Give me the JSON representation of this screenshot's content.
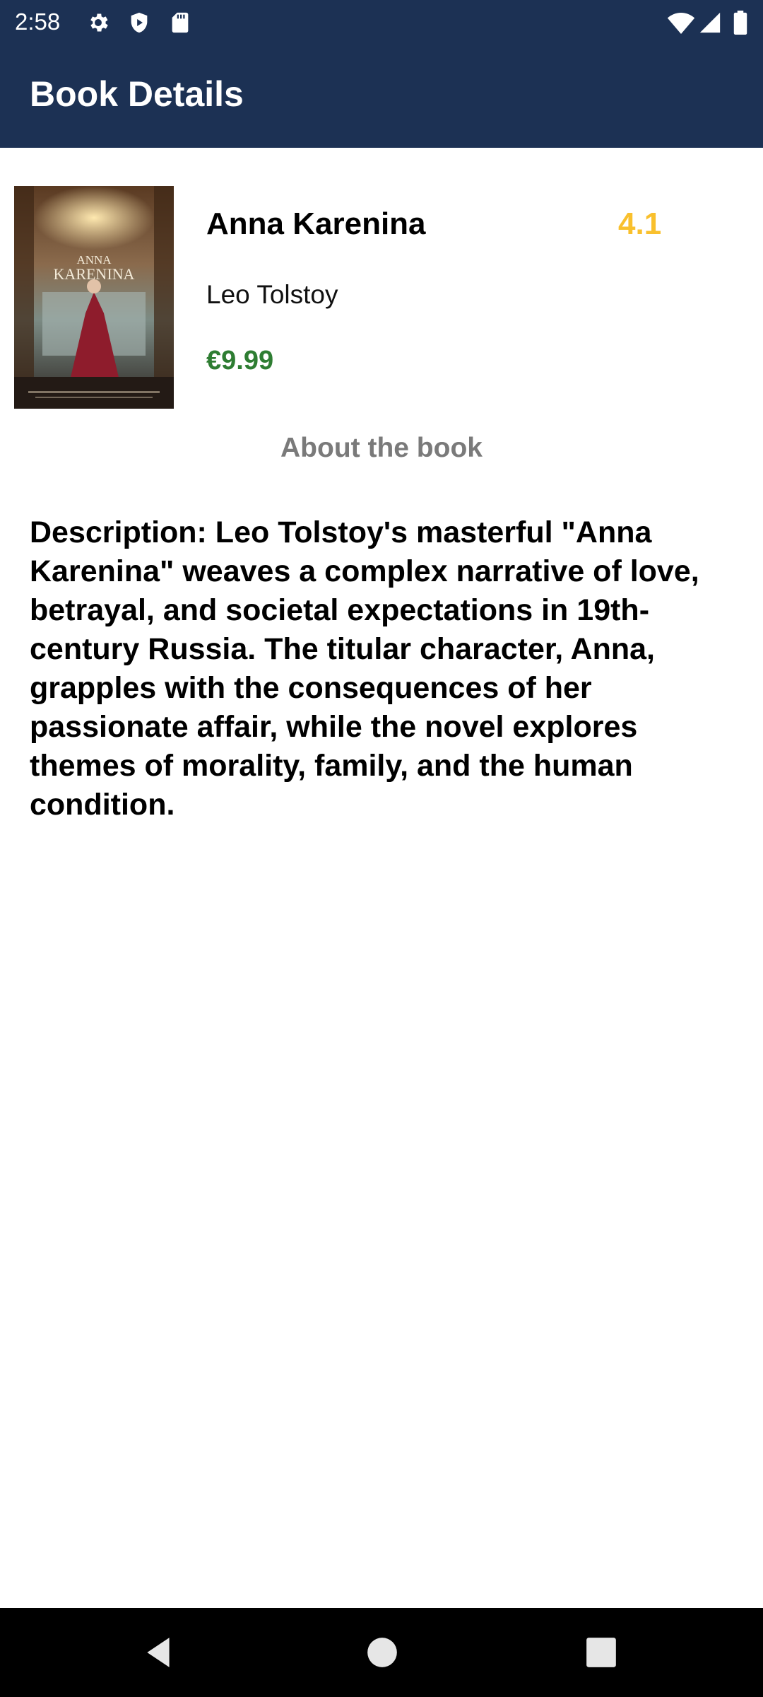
{
  "status_bar": {
    "time": "2:58",
    "left_icons": [
      "gear-icon",
      "shield-play-icon",
      "sd-card-icon"
    ],
    "right_icons": [
      "wifi-icon",
      "cell-signal-icon",
      "battery-icon"
    ]
  },
  "app_bar": {
    "title": "Book Details"
  },
  "book": {
    "title": "Anna Karenina",
    "author": "Leo Tolstoy",
    "rating": "4.1",
    "price": "€9.99",
    "cover_text_line1": "ANNA",
    "cover_text_line2": "KARENINA"
  },
  "about": {
    "heading": "About the book",
    "description": "Description: Leo Tolstoy's masterful \"Anna Karenina\" weaves a complex narrative of love, betrayal, and societal expectations in 19th-century Russia. The titular character, Anna, grapples with the consequences of her passionate affair, while the novel explores themes of morality, family, and the human condition."
  },
  "nav_bar": {
    "buttons": [
      "back-icon",
      "home-icon",
      "recents-icon"
    ]
  },
  "colors": {
    "app_bar": "#1c3154",
    "rating": "#f9c02d",
    "price": "#2e7d32",
    "section_heading": "#7a7a7a"
  }
}
